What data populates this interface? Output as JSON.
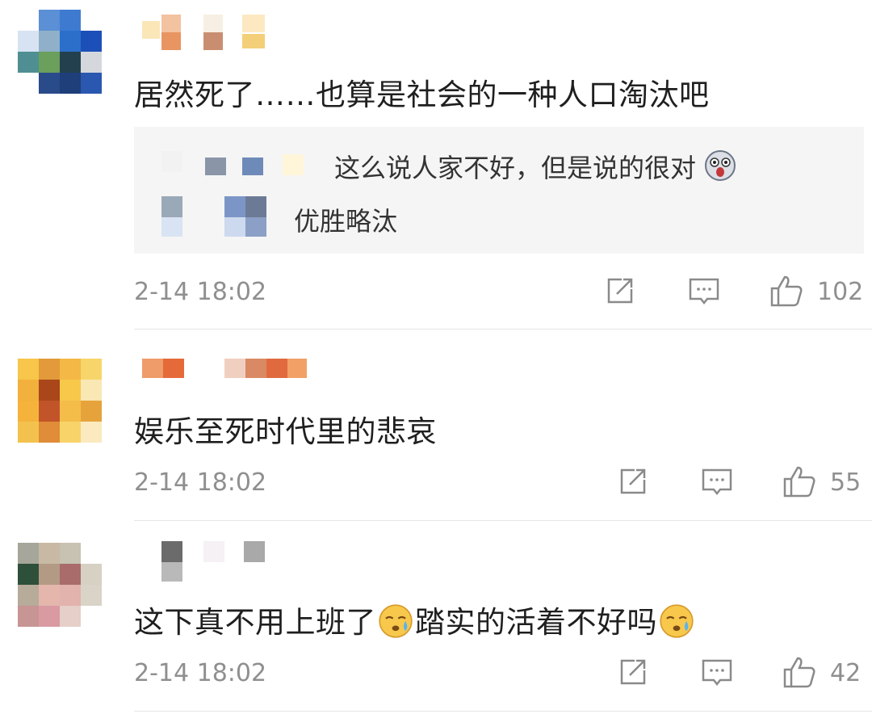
{
  "comments": [
    {
      "text": "居然死了……也算是社会的一种人口淘汰吧",
      "replies": [
        {
          "text": "这么说人家不好，但是说的很对"
        },
        {
          "text": "优胜略汰"
        }
      ],
      "time": "2-14 18:02",
      "likes": "102"
    },
    {
      "text": "娱乐至死时代里的悲哀",
      "time": "2-14 18:02",
      "likes": "55"
    },
    {
      "text_a": "这下真不用上班了",
      "text_b": "踏实的活着不好吗",
      "time": "2-14 18:02",
      "likes": "42"
    }
  ],
  "icons": {
    "share": "share-icon",
    "comment": "comment-icon",
    "like": "thumbs-up-icon",
    "emoji_sad": "sweat-face-emoji",
    "emoji_scared": "scared-face-emoji"
  },
  "colors": {
    "meta_gray": "#8f8f8f",
    "reply_bg": "#f5f5f5",
    "divider": "#e6e6e6"
  }
}
